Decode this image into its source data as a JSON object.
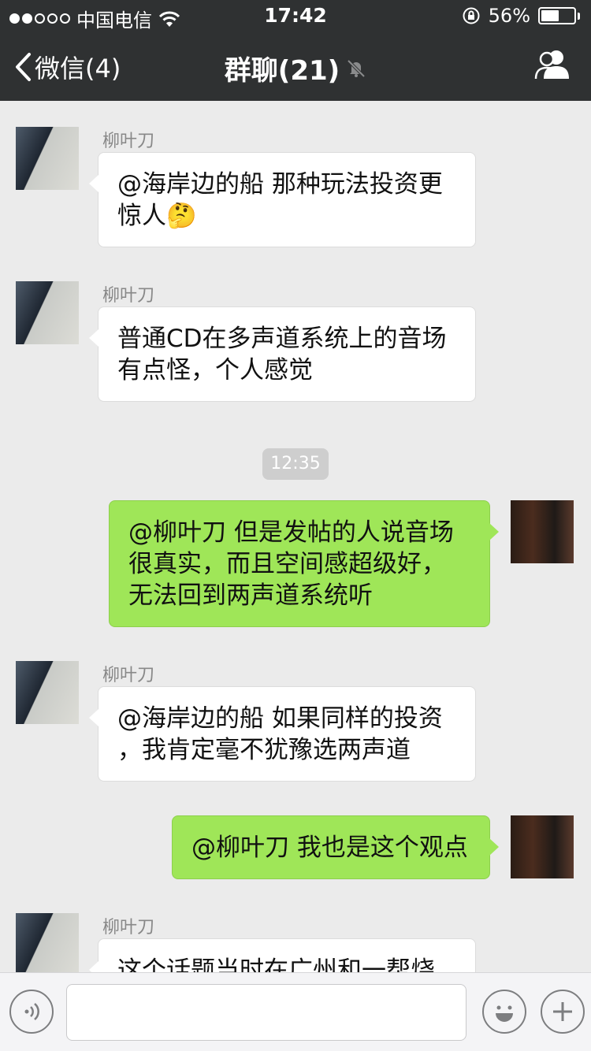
{
  "status_bar": {
    "carrier": "中国电信",
    "time": "17:42",
    "battery_percent": "56%",
    "battery_level": 0.56
  },
  "nav": {
    "back_label": "微信(4)",
    "title": "群聊(21)"
  },
  "chat": {
    "timestamp": "12:35",
    "messages": [
      {
        "direction": "in",
        "sender": "柳叶刀",
        "lines": [
          "@海岸边的船 那种玩法投资更",
          "惊人🤔"
        ]
      },
      {
        "direction": "in",
        "sender": "柳叶刀",
        "lines": [
          "普通CD在多声道系统上的音场",
          "有点怪，个人感觉"
        ]
      },
      {
        "direction": "out",
        "lines": [
          "@柳叶刀 但是发帖的人说音场",
          "很真实，而且空间感超级好，",
          "无法回到两声道系统听"
        ]
      },
      {
        "direction": "in",
        "sender": "柳叶刀",
        "lines": [
          "@海岸边的船 如果同样的投资",
          "，我肯定毫不犹豫选两声道"
        ]
      },
      {
        "direction": "out",
        "lines": [
          "@柳叶刀 我也是这个观点"
        ]
      },
      {
        "direction": "in",
        "sender": "柳叶刀",
        "lines": [
          "这个话题当时在广州和一帮烧"
        ]
      }
    ]
  },
  "input_bar": {
    "text_value": "",
    "icons": [
      "voice-icon",
      "emoji-icon",
      "plus-icon"
    ]
  },
  "colors": {
    "bar_bg": "#2f3132",
    "chat_bg": "#ebebeb",
    "bubble_out": "#9fe658",
    "bubble_in": "#ffffff"
  }
}
